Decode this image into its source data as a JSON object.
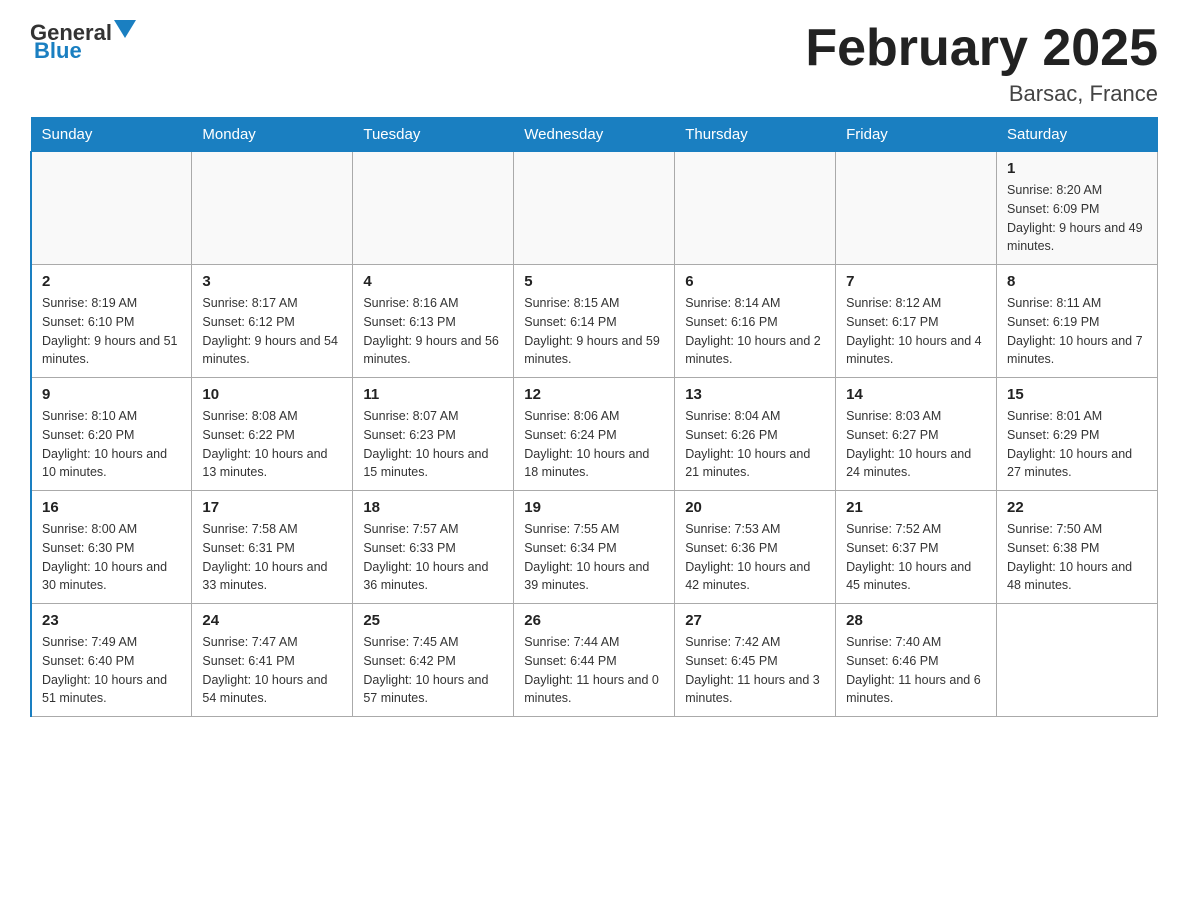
{
  "header": {
    "logo_general": "General",
    "logo_blue": "Blue",
    "month_title": "February 2025",
    "location": "Barsac, France"
  },
  "days_of_week": [
    "Sunday",
    "Monday",
    "Tuesday",
    "Wednesday",
    "Thursday",
    "Friday",
    "Saturday"
  ],
  "weeks": [
    [
      {
        "day": "",
        "info": ""
      },
      {
        "day": "",
        "info": ""
      },
      {
        "day": "",
        "info": ""
      },
      {
        "day": "",
        "info": ""
      },
      {
        "day": "",
        "info": ""
      },
      {
        "day": "",
        "info": ""
      },
      {
        "day": "1",
        "info": "Sunrise: 8:20 AM\nSunset: 6:09 PM\nDaylight: 9 hours and 49 minutes."
      }
    ],
    [
      {
        "day": "2",
        "info": "Sunrise: 8:19 AM\nSunset: 6:10 PM\nDaylight: 9 hours and 51 minutes."
      },
      {
        "day": "3",
        "info": "Sunrise: 8:17 AM\nSunset: 6:12 PM\nDaylight: 9 hours and 54 minutes."
      },
      {
        "day": "4",
        "info": "Sunrise: 8:16 AM\nSunset: 6:13 PM\nDaylight: 9 hours and 56 minutes."
      },
      {
        "day": "5",
        "info": "Sunrise: 8:15 AM\nSunset: 6:14 PM\nDaylight: 9 hours and 59 minutes."
      },
      {
        "day": "6",
        "info": "Sunrise: 8:14 AM\nSunset: 6:16 PM\nDaylight: 10 hours and 2 minutes."
      },
      {
        "day": "7",
        "info": "Sunrise: 8:12 AM\nSunset: 6:17 PM\nDaylight: 10 hours and 4 minutes."
      },
      {
        "day": "8",
        "info": "Sunrise: 8:11 AM\nSunset: 6:19 PM\nDaylight: 10 hours and 7 minutes."
      }
    ],
    [
      {
        "day": "9",
        "info": "Sunrise: 8:10 AM\nSunset: 6:20 PM\nDaylight: 10 hours and 10 minutes."
      },
      {
        "day": "10",
        "info": "Sunrise: 8:08 AM\nSunset: 6:22 PM\nDaylight: 10 hours and 13 minutes."
      },
      {
        "day": "11",
        "info": "Sunrise: 8:07 AM\nSunset: 6:23 PM\nDaylight: 10 hours and 15 minutes."
      },
      {
        "day": "12",
        "info": "Sunrise: 8:06 AM\nSunset: 6:24 PM\nDaylight: 10 hours and 18 minutes."
      },
      {
        "day": "13",
        "info": "Sunrise: 8:04 AM\nSunset: 6:26 PM\nDaylight: 10 hours and 21 minutes."
      },
      {
        "day": "14",
        "info": "Sunrise: 8:03 AM\nSunset: 6:27 PM\nDaylight: 10 hours and 24 minutes."
      },
      {
        "day": "15",
        "info": "Sunrise: 8:01 AM\nSunset: 6:29 PM\nDaylight: 10 hours and 27 minutes."
      }
    ],
    [
      {
        "day": "16",
        "info": "Sunrise: 8:00 AM\nSunset: 6:30 PM\nDaylight: 10 hours and 30 minutes."
      },
      {
        "day": "17",
        "info": "Sunrise: 7:58 AM\nSunset: 6:31 PM\nDaylight: 10 hours and 33 minutes."
      },
      {
        "day": "18",
        "info": "Sunrise: 7:57 AM\nSunset: 6:33 PM\nDaylight: 10 hours and 36 minutes."
      },
      {
        "day": "19",
        "info": "Sunrise: 7:55 AM\nSunset: 6:34 PM\nDaylight: 10 hours and 39 minutes."
      },
      {
        "day": "20",
        "info": "Sunrise: 7:53 AM\nSunset: 6:36 PM\nDaylight: 10 hours and 42 minutes."
      },
      {
        "day": "21",
        "info": "Sunrise: 7:52 AM\nSunset: 6:37 PM\nDaylight: 10 hours and 45 minutes."
      },
      {
        "day": "22",
        "info": "Sunrise: 7:50 AM\nSunset: 6:38 PM\nDaylight: 10 hours and 48 minutes."
      }
    ],
    [
      {
        "day": "23",
        "info": "Sunrise: 7:49 AM\nSunset: 6:40 PM\nDaylight: 10 hours and 51 minutes."
      },
      {
        "day": "24",
        "info": "Sunrise: 7:47 AM\nSunset: 6:41 PM\nDaylight: 10 hours and 54 minutes."
      },
      {
        "day": "25",
        "info": "Sunrise: 7:45 AM\nSunset: 6:42 PM\nDaylight: 10 hours and 57 minutes."
      },
      {
        "day": "26",
        "info": "Sunrise: 7:44 AM\nSunset: 6:44 PM\nDaylight: 11 hours and 0 minutes."
      },
      {
        "day": "27",
        "info": "Sunrise: 7:42 AM\nSunset: 6:45 PM\nDaylight: 11 hours and 3 minutes."
      },
      {
        "day": "28",
        "info": "Sunrise: 7:40 AM\nSunset: 6:46 PM\nDaylight: 11 hours and 6 minutes."
      },
      {
        "day": "",
        "info": ""
      }
    ]
  ]
}
